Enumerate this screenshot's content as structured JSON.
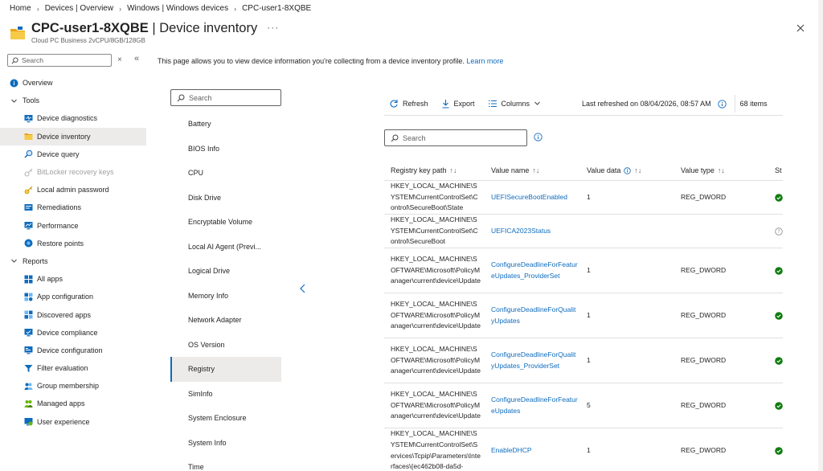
{
  "breadcrumb": [
    "Home",
    "Devices | Overview",
    "Windows | Windows devices",
    "CPC-user1-8XQBE"
  ],
  "header": {
    "title_bold": "CPC-user1-8XQBE",
    "title_rest": " | Device inventory",
    "subtitle": "Cloud PC Business 2vCPU/8GB/128GB",
    "more": "···"
  },
  "nav": {
    "search_placeholder": "Search",
    "items": [
      {
        "label": "Overview",
        "level": 0,
        "icon": "info-icon"
      },
      {
        "label": "Tools",
        "level": 0,
        "group": true
      },
      {
        "label": "Device diagnostics",
        "level": 1,
        "icon": "diagnostics-icon"
      },
      {
        "label": "Device inventory",
        "level": 1,
        "icon": "folder-icon",
        "selected": true
      },
      {
        "label": "Device query",
        "level": 1,
        "icon": "query-icon"
      },
      {
        "label": "BitLocker recovery keys",
        "level": 1,
        "icon": "key-icon",
        "disabled": true
      },
      {
        "label": "Local admin password",
        "level": 1,
        "icon": "password-icon"
      },
      {
        "label": "Remediations",
        "level": 1,
        "icon": "remediation-icon"
      },
      {
        "label": "Performance",
        "level": 1,
        "icon": "performance-icon"
      },
      {
        "label": "Restore points",
        "level": 1,
        "icon": "restore-icon"
      },
      {
        "label": "Reports",
        "level": 0,
        "group": true
      },
      {
        "label": "All apps",
        "level": 1,
        "icon": "apps-icon"
      },
      {
        "label": "App configuration",
        "level": 1,
        "icon": "app-config-icon"
      },
      {
        "label": "Discovered apps",
        "level": 1,
        "icon": "discovered-apps-icon"
      },
      {
        "label": "Device compliance",
        "level": 1,
        "icon": "compliance-icon"
      },
      {
        "label": "Device configuration",
        "level": 1,
        "icon": "configuration-icon"
      },
      {
        "label": "Filter evaluation",
        "level": 1,
        "icon": "filter-icon"
      },
      {
        "label": "Group membership",
        "level": 1,
        "icon": "group-icon"
      },
      {
        "label": "Managed apps",
        "level": 1,
        "icon": "managed-apps-icon"
      },
      {
        "label": "User experience",
        "level": 1,
        "icon": "user-experience-icon"
      }
    ]
  },
  "description": {
    "text": "This page allows you to view device information you're collecting from a device inventory profile. ",
    "link": "Learn more"
  },
  "categories": {
    "search_placeholder": "Search",
    "items": [
      "Battery",
      "BIOS Info",
      "CPU",
      "Disk Drive",
      "Encryptable Volume",
      "Local AI Agent (Previ...",
      "Logical Drive",
      "Memory Info",
      "Network Adapter",
      "OS Version",
      "Registry",
      "SimInfo",
      "System Enclosure",
      "System Info",
      "Time"
    ],
    "selected": "Registry"
  },
  "toolbar": {
    "refresh": "Refresh",
    "export": "Export",
    "columns": "Columns",
    "last_refreshed": "Last refreshed on 08/04/2026, 08:57 AM",
    "count": "68 items"
  },
  "table": {
    "search_placeholder": "Search",
    "headers": {
      "path": "Registry key path",
      "name": "Value name",
      "data": "Value data",
      "type": "Value type",
      "status": "St"
    },
    "rows": [
      {
        "path": "HKEY_LOCAL_MACHINE\\SYSTEM\\CurrentControlSet\\Control\\SecureBoot\\State",
        "name": "UEFISecureBootEnabled",
        "data": "1",
        "type": "REG_DWORD",
        "status": "success"
      },
      {
        "path": "HKEY_LOCAL_MACHINE\\SYSTEM\\CurrentControlSet\\Control\\SecureBoot",
        "name": "UEFICA2023Status",
        "data": "",
        "type": "",
        "status": "unknown"
      },
      {
        "path": "HKEY_LOCAL_MACHINE\\SOFTWARE\\Microsoft\\PolicyManager\\current\\device\\Update",
        "name": "ConfigureDeadlineForFeatureUpdates_ProviderSet",
        "data": "1",
        "type": "REG_DWORD",
        "status": "success"
      },
      {
        "path": "HKEY_LOCAL_MACHINE\\SOFTWARE\\Microsoft\\PolicyManager\\current\\device\\Update",
        "name": "ConfigureDeadlineForQualityUpdates",
        "data": "1",
        "type": "REG_DWORD",
        "status": "success"
      },
      {
        "path": "HKEY_LOCAL_MACHINE\\SOFTWARE\\Microsoft\\PolicyManager\\current\\device\\Update",
        "name": "ConfigureDeadlineForQualityUpdates_ProviderSet",
        "data": "1",
        "type": "REG_DWORD",
        "status": "success"
      },
      {
        "path": "HKEY_LOCAL_MACHINE\\SOFTWARE\\Microsoft\\PolicyManager\\current\\device\\Update",
        "name": "ConfigureDeadlineForFeatureUpdates",
        "data": "5",
        "type": "REG_DWORD",
        "status": "success"
      },
      {
        "path": "HKEY_LOCAL_MACHINE\\SYSTEM\\CurrentControlSet\\Services\\Tcpip\\Parameters\\Interfaces\\{ec462b08-da5d-",
        "name": "EnableDHCP",
        "data": "1",
        "type": "REG_DWORD",
        "status": "success"
      }
    ]
  },
  "colors": {
    "accent": "#0f6cbd",
    "success": "#107c10",
    "selected_bg": "#edebe9"
  }
}
